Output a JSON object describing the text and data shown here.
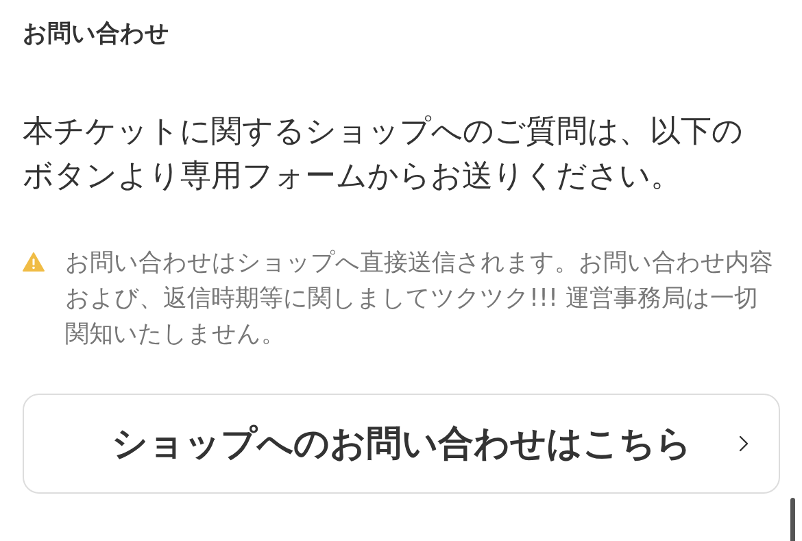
{
  "section_title": "お問い合わせ",
  "description": "本チケットに関するショップへのご質問は、以下のボタンより専用フォームからお送りください。",
  "notice": {
    "text": "お問い合わせはショップへ直接送信されます。お問い合わせ内容および、返信時期等に関しましてツクツク!!! 運営事務局は一切関知いたしません。"
  },
  "contact_button": {
    "label": "ショップへのお問い合わせはこちら"
  }
}
